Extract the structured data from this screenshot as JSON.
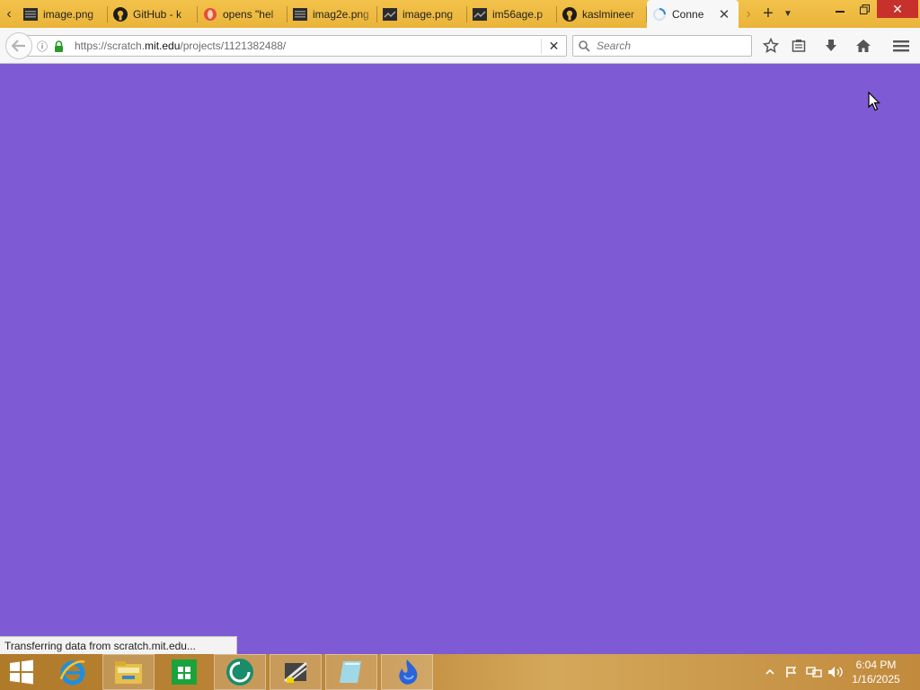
{
  "browser": {
    "tabs": [
      {
        "label": "image.png",
        "icon": "image-file-icon",
        "active": false
      },
      {
        "label": "GitHub - k",
        "icon": "github-icon",
        "active": false
      },
      {
        "label": "opens \"hel",
        "icon": "opera-icon",
        "active": false
      },
      {
        "label": "imag2e.png",
        "icon": "image-file-icon",
        "active": false
      },
      {
        "label": "image.png",
        "icon": "image-file-icon",
        "active": false
      },
      {
        "label": "im56age.p",
        "icon": "image-file-icon",
        "active": false
      },
      {
        "label": "kaslmineer",
        "icon": "github-icon",
        "active": false
      },
      {
        "label": "Conne",
        "icon": "loading-spinner-icon",
        "active": true
      }
    ],
    "url": {
      "prefix": "https://scratch.",
      "domain": "mit.edu",
      "path": "/projects/1121382488/"
    },
    "search": {
      "placeholder": "Search"
    },
    "status_text": "Transferring data from scratch.mit.edu...",
    "page_background": "#7e5ad5"
  },
  "taskbar": {
    "apps": [
      {
        "name": "internet-explorer-icon"
      },
      {
        "name": "file-explorer-icon"
      },
      {
        "name": "windows-store-icon"
      },
      {
        "name": "app-green-circle-icon"
      },
      {
        "name": "app-scanner-icon"
      },
      {
        "name": "app-notepad-icon"
      },
      {
        "name": "firefox-icon"
      }
    ],
    "clock": {
      "time": "6:04 PM",
      "date": "1/16/2025"
    }
  }
}
